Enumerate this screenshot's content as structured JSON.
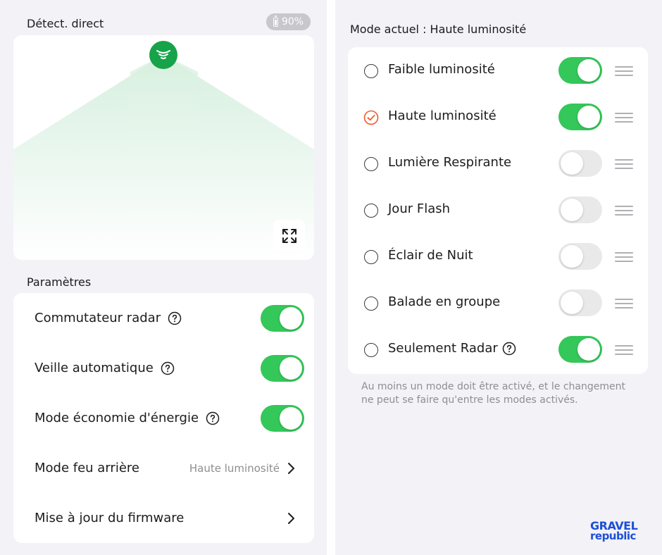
{
  "left": {
    "live_label": "Détect. direct",
    "battery": "90%",
    "settings_label": "Paramètres",
    "rows": [
      {
        "label": "Commutateur radar",
        "type": "toggle",
        "on": true
      },
      {
        "label": "Veille automatique",
        "type": "toggle",
        "on": true
      },
      {
        "label": "Mode économie d'énergie",
        "type": "toggle",
        "on": true
      },
      {
        "label": "Mode feu arrière",
        "type": "nav",
        "value": "Haute luminosité"
      },
      {
        "label": "Mise à jour du firmware",
        "type": "nav"
      }
    ]
  },
  "right": {
    "current_mode": "Mode actuel : Haute luminosité",
    "modes": [
      {
        "label": "Faible luminosité",
        "selected": false,
        "on": true
      },
      {
        "label": "Haute luminosité",
        "selected": true,
        "on": true
      },
      {
        "label": "Lumière Respirante",
        "selected": false,
        "on": false
      },
      {
        "label": "Jour Flash",
        "selected": false,
        "on": false
      },
      {
        "label": "Éclair de Nuit",
        "selected": false,
        "on": false
      },
      {
        "label": "Balade en groupe",
        "selected": false,
        "on": false
      },
      {
        "label": "Seulement Radar",
        "selected": false,
        "on": true,
        "help": true
      }
    ],
    "footnote": "Au moins un mode doit être activé, et le changement ne peut se faire qu'entre les modes activés."
  },
  "brand": {
    "line1": "GRAVEL",
    "line2": "republic"
  },
  "colors": {
    "accent_green": "#34c759",
    "selected_orange": "#ee5a2e",
    "radar_green": "#16a34a",
    "brand_blue": "#1e4fd8"
  },
  "icons": [
    "battery-icon",
    "radar-signal-icon",
    "expand-icon",
    "help-icon",
    "chevron-right-icon",
    "radio-check-icon",
    "drag-handle-icon"
  ]
}
